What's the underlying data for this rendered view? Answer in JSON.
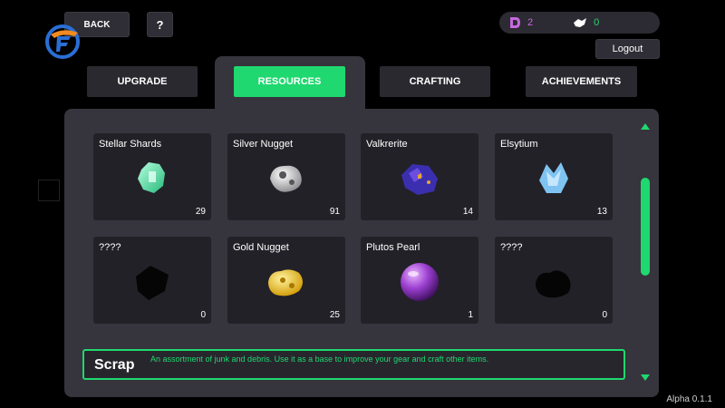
{
  "header": {
    "back_label": "BACK",
    "help_label": "?",
    "logout_label": "Logout"
  },
  "currency": {
    "gems": "2",
    "crystals": "0",
    "gem_color": "#c768e0",
    "crystal_color": "#1fd86f"
  },
  "tabs": [
    {
      "label": "UPGRADE",
      "active": false
    },
    {
      "label": "RESOURCES",
      "active": true
    },
    {
      "label": "CRAFTING",
      "active": false
    },
    {
      "label": "ACHIEVEMENTS",
      "active": false
    }
  ],
  "resources": [
    {
      "name": "Stellar Shards",
      "count": "29",
      "icon": "stellar-shard-icon"
    },
    {
      "name": "Silver Nugget",
      "count": "91",
      "icon": "silver-nugget-icon"
    },
    {
      "name": "Valkrerite",
      "count": "14",
      "icon": "valkrerite-icon"
    },
    {
      "name": "Elsytium",
      "count": "13",
      "icon": "elsytium-icon"
    },
    {
      "name": "????",
      "count": "0",
      "icon": "unknown-resource-icon"
    },
    {
      "name": "Gold Nugget",
      "count": "25",
      "icon": "gold-nugget-icon"
    },
    {
      "name": "Plutos Pearl",
      "count": "1",
      "icon": "plutos-pearl-icon"
    },
    {
      "name": "????",
      "count": "0",
      "icon": "unknown-resource-icon"
    }
  ],
  "description": {
    "title": "Scrap",
    "text": "An assortment of junk and debris. Use it as a base to improve your gear and craft other items."
  },
  "version": "Alpha 0.1.1",
  "colors": {
    "accent": "#1fd86f",
    "panel": "#36343c",
    "card": "#232128"
  }
}
